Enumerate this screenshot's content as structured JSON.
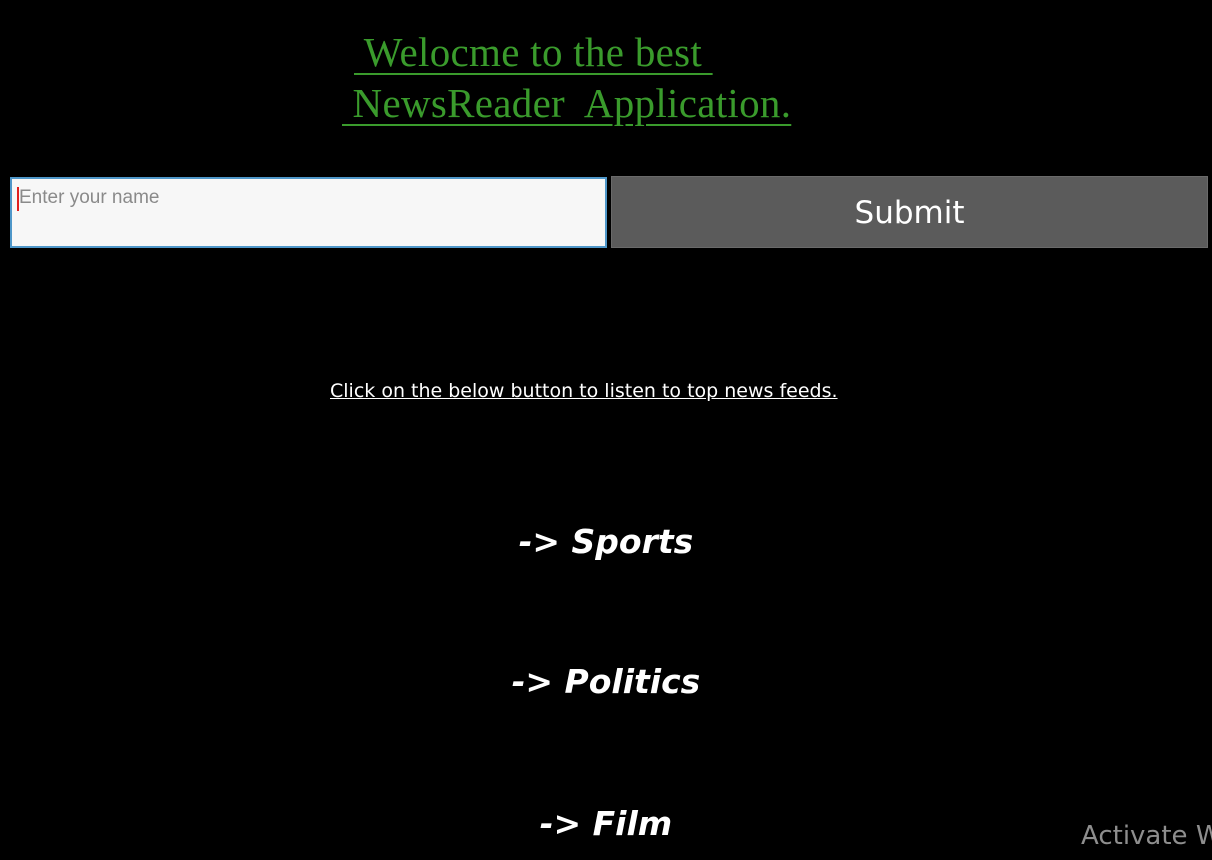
{
  "header": {
    "title_line_1": " Welocme to the best ",
    "title_line_2": " NewsReader  Application."
  },
  "name_form": {
    "input_placeholder": "Enter your name",
    "input_value": "",
    "submit_label": "Submit"
  },
  "instruction": "Click on the below button to listen to top news feeds.",
  "categories": [
    {
      "label": "-> Sports"
    },
    {
      "label": "-> Politics"
    },
    {
      "label": "-> Film"
    }
  ],
  "watermark": "Activate W",
  "colors": {
    "background": "#000000",
    "title": "#3a9b2c",
    "input_border": "#4f97c9",
    "button": "#5b5b5b"
  }
}
